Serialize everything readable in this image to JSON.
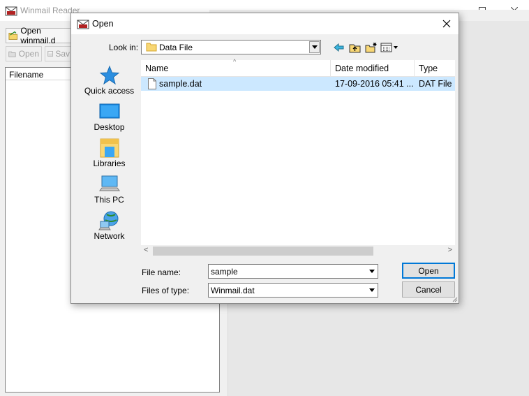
{
  "app": {
    "title": "Winmail Reader",
    "toolbar": {
      "open_winmail_label": "Open winmail.d",
      "open_label": "Open",
      "save_label": "Sav"
    },
    "file_list": {
      "header": "Filename"
    }
  },
  "dialog": {
    "title": "Open",
    "look_in_label": "Look in:",
    "look_in_value": "Data File",
    "places": [
      {
        "label": "Quick access",
        "icon": "star-icon"
      },
      {
        "label": "Desktop",
        "icon": "desktop-icon"
      },
      {
        "label": "Libraries",
        "icon": "libraries-icon"
      },
      {
        "label": "This PC",
        "icon": "computer-icon"
      },
      {
        "label": "Network",
        "icon": "network-icon"
      }
    ],
    "columns": [
      "Name",
      "Date modified",
      "Type"
    ],
    "files": [
      {
        "name": "sample.dat",
        "date": "17-09-2016 05:41 ...",
        "type": "DAT File"
      }
    ],
    "file_name_label": "File name:",
    "file_name_value": "sample",
    "files_of_type_label": "Files of type:",
    "files_of_type_value": "Winmail.dat",
    "open_button": "Open",
    "cancel_button": "Cancel"
  },
  "colors": {
    "selection": "#cce8ff",
    "accent": "#0078d7"
  }
}
